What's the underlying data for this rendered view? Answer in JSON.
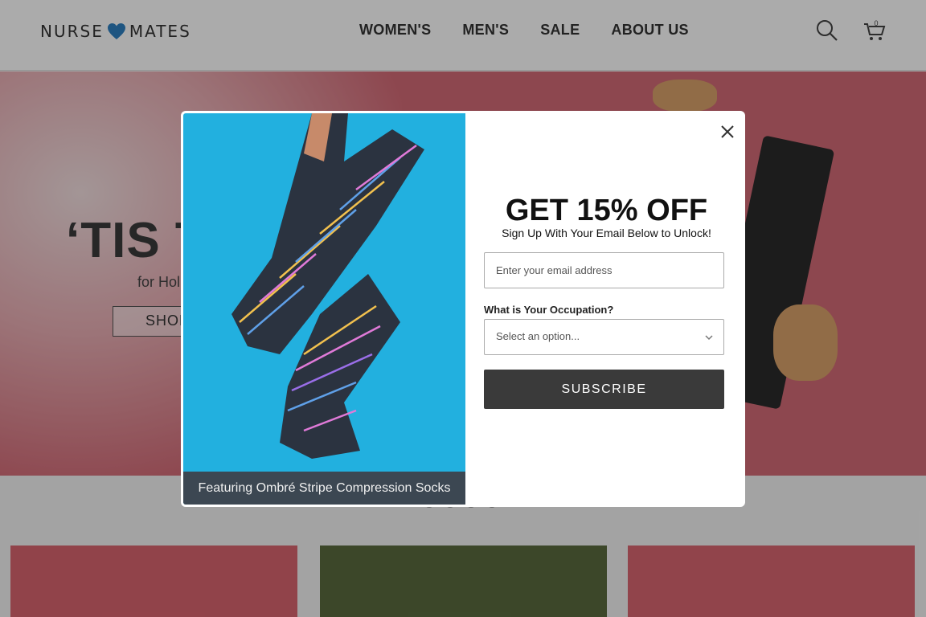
{
  "header": {
    "logo_left": "NURSE",
    "logo_right": "MATES",
    "logo_mark": "heart-logo",
    "nav": [
      "WOMEN'S",
      "MEN'S",
      "SALE",
      "ABOUT US"
    ],
    "icons": [
      "search-icon",
      "cart-icon"
    ],
    "cart_count": "0"
  },
  "hero": {
    "title": "‘TIS TI",
    "subtitle": "for Holi",
    "button": "SHOP"
  },
  "modal": {
    "title": "GET 15% OFF",
    "subtitle": "Sign Up With Your Email Below to Unlock!",
    "email_placeholder": "Enter your email address",
    "occupation_label": "What is Your Occupation?",
    "occupation_selected": "Select an option...",
    "subscribe_label": "SUBSCRIBE",
    "caption": "Featuring Ombré Stripe Compression Socks",
    "close_icon": "close-icon"
  },
  "colors": {
    "hero_bg": "#d36a76",
    "modal_image_bg": "#22b0df",
    "caption_bg": "#3c4752",
    "subscribe_bg": "#3a3a3a",
    "logo_heart": "#2d7fc1"
  }
}
